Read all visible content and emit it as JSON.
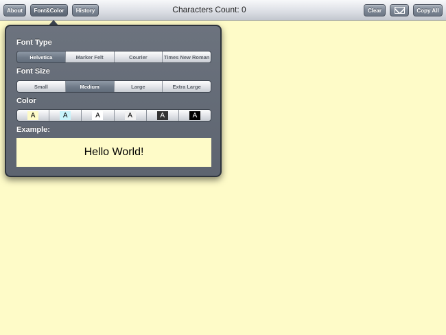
{
  "toolbar": {
    "about_label": "About",
    "font_color_label": "Font&Color",
    "history_label": "History",
    "title": "Characters Count: 0",
    "clear_label": "Clear",
    "mail_icon": "mail-icon",
    "copy_all_label": "Copy All"
  },
  "popover": {
    "font_type_label": "Font Type",
    "font_types": [
      "Helvetica",
      "Marker Felt",
      "Courier",
      "Times New Roman"
    ],
    "font_type_selected": "Helvetica",
    "font_size_label": "Font Size",
    "font_sizes": [
      "Small",
      "Medium",
      "Large",
      "Extra Large"
    ],
    "font_size_selected": "Medium",
    "color_label": "Color",
    "color_options": [
      {
        "glyph": "A",
        "bg": "#fefbc8",
        "fg": "#000000"
      },
      {
        "glyph": "A",
        "bg": "#c8f4fb",
        "fg": "#000000"
      },
      {
        "glyph": "A",
        "bg": "#ffffff",
        "fg": "#000000"
      },
      {
        "glyph": "A",
        "bg": "#f2f2f2",
        "fg": "#000000"
      },
      {
        "glyph": "A",
        "bg": "#333333",
        "fg": "#ffffff"
      },
      {
        "glyph": "A",
        "bg": "#000000",
        "fg": "#ffffff"
      }
    ],
    "color_selected_index": 0,
    "example_label": "Example:",
    "example_text": "Hello World!"
  },
  "colors": {
    "page_background": "#fefbc8",
    "popover_background": "#656c78",
    "toolbar_button": "#7e8896"
  }
}
